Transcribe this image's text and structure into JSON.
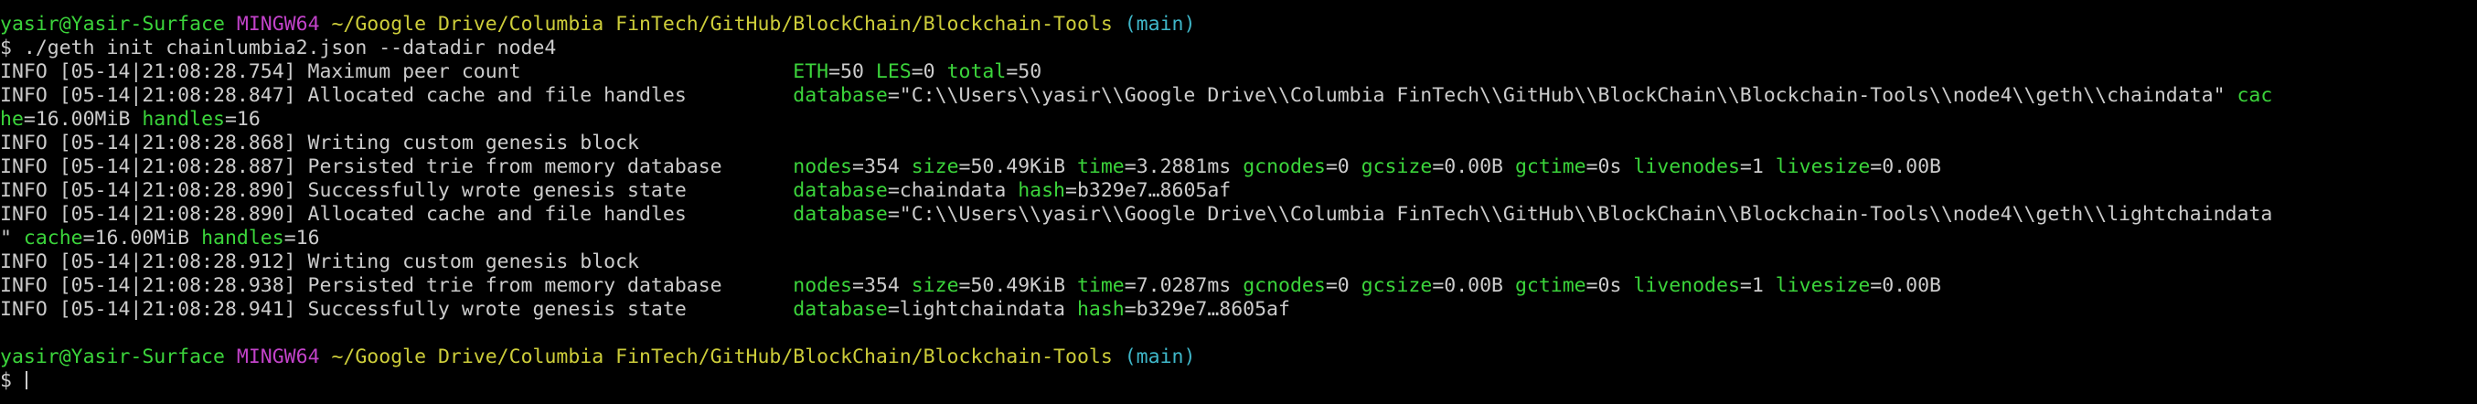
{
  "terminal": {
    "colors": {
      "background": "#000000",
      "text": "#cccccc",
      "key": "#3bd43b",
      "user_host": "#3bd43b",
      "shell": "#c242c9",
      "path": "#cdcd3a",
      "branch": "#3fb7c9"
    },
    "lines": [
      {
        "type": "prompt-header",
        "segments": [
          {
            "text": "yasir@Yasir-Surface",
            "color": "green"
          },
          {
            "text": " ",
            "color": "text"
          },
          {
            "text": "MINGW64",
            "color": "purple"
          },
          {
            "text": " ",
            "color": "text"
          },
          {
            "text": "~/Google Drive/Columbia FinTech/GitHub/BlockChain/Blockchain-Tools",
            "color": "yellow"
          },
          {
            "text": " ",
            "color": "text"
          },
          {
            "text": "(main)",
            "color": "cyan"
          }
        ]
      },
      {
        "type": "command",
        "segments": [
          {
            "text": "$ ./geth init chainlumbia2.json --datadir node4",
            "color": "text"
          }
        ]
      },
      {
        "type": "log",
        "segments": [
          {
            "text": "INFO [05-14|21:08:28.754] Maximum peer count                       ",
            "color": "text"
          },
          {
            "text": "ETH",
            "color": "green"
          },
          {
            "text": "=50 ",
            "color": "text"
          },
          {
            "text": "LES",
            "color": "green"
          },
          {
            "text": "=0 ",
            "color": "text"
          },
          {
            "text": "total",
            "color": "green"
          },
          {
            "text": "=50",
            "color": "text"
          }
        ]
      },
      {
        "type": "log",
        "segments": [
          {
            "text": "INFO [05-14|21:08:28.847] Allocated cache and file handles         ",
            "color": "text"
          },
          {
            "text": "database",
            "color": "green"
          },
          {
            "text": "=\"C:\\\\Users\\\\yasir\\\\Google Drive\\\\Columbia FinTech\\\\GitHub\\\\BlockChain\\\\Blockchain-Tools\\\\node4\\\\geth\\\\chaindata\" ",
            "color": "text"
          },
          {
            "text": "cac",
            "color": "green"
          }
        ]
      },
      {
        "type": "log-wrap",
        "segments": [
          {
            "text": "he",
            "color": "green"
          },
          {
            "text": "=16.00MiB ",
            "color": "text"
          },
          {
            "text": "handles",
            "color": "green"
          },
          {
            "text": "=16",
            "color": "text"
          }
        ]
      },
      {
        "type": "log",
        "segments": [
          {
            "text": "INFO [05-14|21:08:28.868] Writing custom genesis block",
            "color": "text"
          }
        ]
      },
      {
        "type": "log",
        "segments": [
          {
            "text": "INFO [05-14|21:08:28.887] Persisted trie from memory database      ",
            "color": "text"
          },
          {
            "text": "nodes",
            "color": "green"
          },
          {
            "text": "=354 ",
            "color": "text"
          },
          {
            "text": "size",
            "color": "green"
          },
          {
            "text": "=50.49KiB ",
            "color": "text"
          },
          {
            "text": "time",
            "color": "green"
          },
          {
            "text": "=3.2881ms ",
            "color": "text"
          },
          {
            "text": "gcnodes",
            "color": "green"
          },
          {
            "text": "=0 ",
            "color": "text"
          },
          {
            "text": "gcsize",
            "color": "green"
          },
          {
            "text": "=0.00B ",
            "color": "text"
          },
          {
            "text": "gctime",
            "color": "green"
          },
          {
            "text": "=0s ",
            "color": "text"
          },
          {
            "text": "livenodes",
            "color": "green"
          },
          {
            "text": "=1 ",
            "color": "text"
          },
          {
            "text": "livesize",
            "color": "green"
          },
          {
            "text": "=0.00B",
            "color": "text"
          }
        ]
      },
      {
        "type": "log",
        "segments": [
          {
            "text": "INFO [05-14|21:08:28.890] Successfully wrote genesis state         ",
            "color": "text"
          },
          {
            "text": "database",
            "color": "green"
          },
          {
            "text": "=chaindata ",
            "color": "text"
          },
          {
            "text": "hash",
            "color": "green"
          },
          {
            "text": "=b329e7…8605af",
            "color": "text"
          }
        ]
      },
      {
        "type": "log",
        "segments": [
          {
            "text": "INFO [05-14|21:08:28.890] Allocated cache and file handles         ",
            "color": "text"
          },
          {
            "text": "database",
            "color": "green"
          },
          {
            "text": "=\"C:\\\\Users\\\\yasir\\\\Google Drive\\\\Columbia FinTech\\\\GitHub\\\\BlockChain\\\\Blockchain-Tools\\\\node4\\\\geth\\\\lightchaindata",
            "color": "text"
          }
        ]
      },
      {
        "type": "log-wrap",
        "segments": [
          {
            "text": "\" ",
            "color": "text"
          },
          {
            "text": "cache",
            "color": "green"
          },
          {
            "text": "=16.00MiB ",
            "color": "text"
          },
          {
            "text": "handles",
            "color": "green"
          },
          {
            "text": "=16",
            "color": "text"
          }
        ]
      },
      {
        "type": "log",
        "segments": [
          {
            "text": "INFO [05-14|21:08:28.912] Writing custom genesis block",
            "color": "text"
          }
        ]
      },
      {
        "type": "log",
        "segments": [
          {
            "text": "INFO [05-14|21:08:28.938] Persisted trie from memory database      ",
            "color": "text"
          },
          {
            "text": "nodes",
            "color": "green"
          },
          {
            "text": "=354 ",
            "color": "text"
          },
          {
            "text": "size",
            "color": "green"
          },
          {
            "text": "=50.49KiB ",
            "color": "text"
          },
          {
            "text": "time",
            "color": "green"
          },
          {
            "text": "=7.0287ms ",
            "color": "text"
          },
          {
            "text": "gcnodes",
            "color": "green"
          },
          {
            "text": "=0 ",
            "color": "text"
          },
          {
            "text": "gcsize",
            "color": "green"
          },
          {
            "text": "=0.00B ",
            "color": "text"
          },
          {
            "text": "gctime",
            "color": "green"
          },
          {
            "text": "=0s ",
            "color": "text"
          },
          {
            "text": "livenodes",
            "color": "green"
          },
          {
            "text": "=1 ",
            "color": "text"
          },
          {
            "text": "livesize",
            "color": "green"
          },
          {
            "text": "=0.00B",
            "color": "text"
          }
        ]
      },
      {
        "type": "log",
        "segments": [
          {
            "text": "INFO [05-14|21:08:28.941] Successfully wrote genesis state         ",
            "color": "text"
          },
          {
            "text": "database",
            "color": "green"
          },
          {
            "text": "=lightchaindata ",
            "color": "text"
          },
          {
            "text": "hash",
            "color": "green"
          },
          {
            "text": "=b329e7…8605af",
            "color": "text"
          }
        ]
      },
      {
        "type": "blank",
        "segments": []
      },
      {
        "type": "prompt-header",
        "segments": [
          {
            "text": "yasir@Yasir-Surface",
            "color": "green"
          },
          {
            "text": " ",
            "color": "text"
          },
          {
            "text": "MINGW64",
            "color": "purple"
          },
          {
            "text": " ",
            "color": "text"
          },
          {
            "text": "~/Google Drive/Columbia FinTech/GitHub/BlockChain/Blockchain-Tools",
            "color": "yellow"
          },
          {
            "text": " ",
            "color": "text"
          },
          {
            "text": "(main)",
            "color": "cyan"
          }
        ]
      },
      {
        "type": "input-prompt",
        "segments": [
          {
            "text": "$ ",
            "color": "text"
          }
        ]
      }
    ]
  }
}
